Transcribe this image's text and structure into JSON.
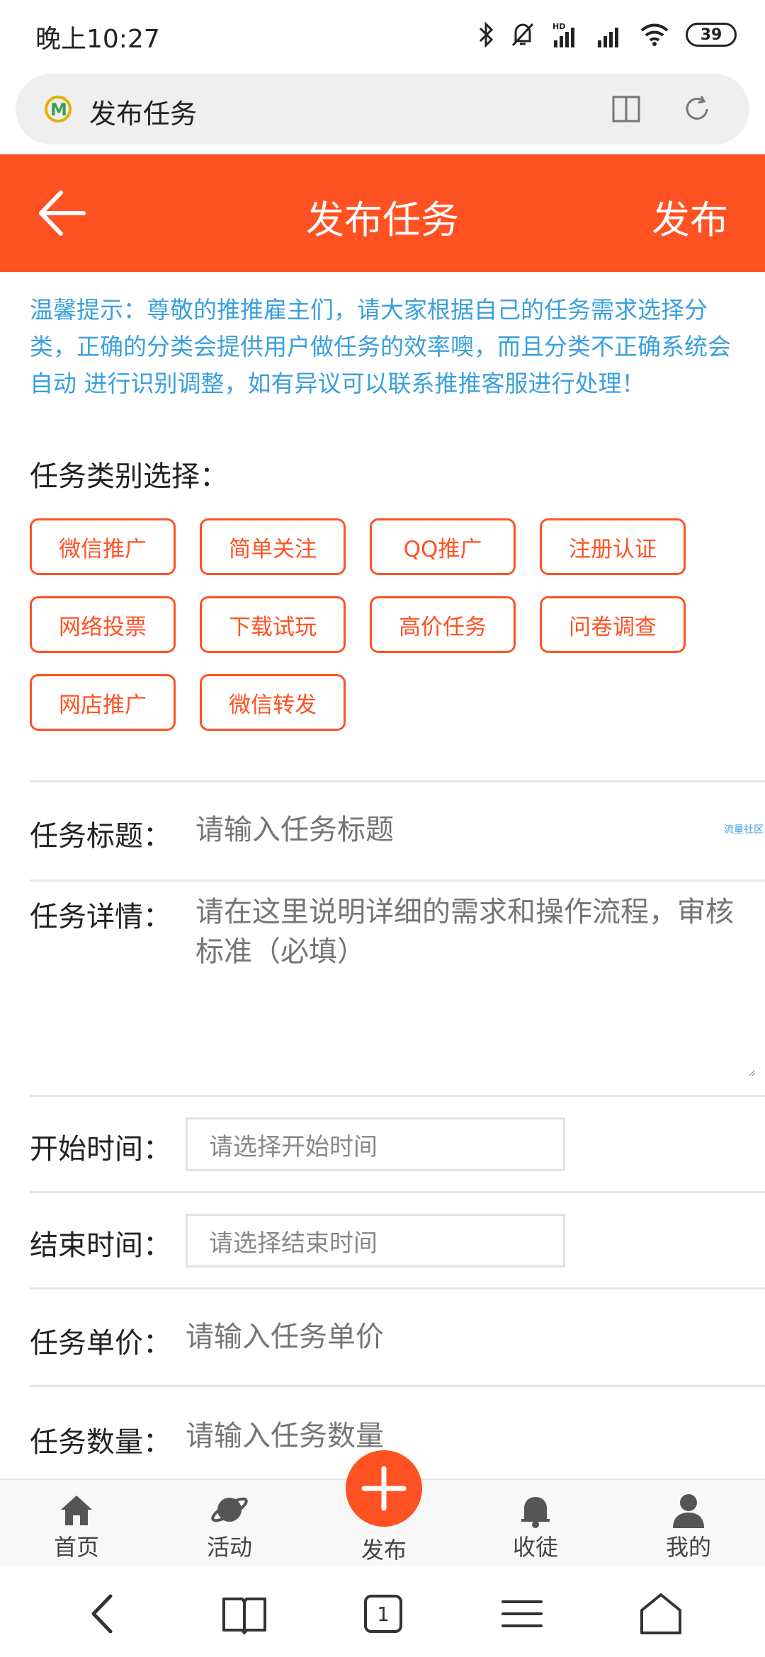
{
  "status_bar": {
    "time": "晚上10:27",
    "battery": "39",
    "icons": [
      "bluetooth-icon",
      "bell-muted-icon",
      "hd-signal-icon",
      "signal-icon",
      "wifi-icon",
      "battery-icon"
    ]
  },
  "browser": {
    "page_title": "发布任务",
    "logo_icon": "site-logo-icon",
    "reader_icon": "reader-mode-icon",
    "reload_icon": "reload-icon"
  },
  "header": {
    "title": "发布任务",
    "publish": "发布",
    "back_icon": "arrow-left-icon"
  },
  "tip": "温馨提示：尊敬的推推雇主们，请大家根据自己的任务需求选择分类，正确的分类会提供用户做任务的效率噢，而且分类不正确系统会自动 进行识别调整，如有异议可以联系推推客服进行处理！",
  "category_label": "任务类别选择：",
  "categories": [
    "微信推广",
    "简单关注",
    "QQ推广",
    "注册认证",
    "网络投票",
    "下载试玩",
    "高价任务",
    "问卷调查",
    "网店推广",
    "微信转发"
  ],
  "form": {
    "title_label": "任务标题：",
    "title_placeholder": "请输入任务标题",
    "detail_label": "任务详情：",
    "detail_placeholder": "请在这里说明详细的需求和操作流程，审核标准（必填）",
    "start_label": "开始时间：",
    "start_placeholder": "请选择开始时间",
    "end_label": "结束时间：",
    "end_placeholder": "请选择结束时间",
    "price_label": "任务单价：",
    "price_placeholder": "请输入任务单价",
    "qty_label": "任务数量：",
    "qty_placeholder": "请输入任务数量"
  },
  "watermark": "流量社区",
  "colors": {
    "accent": "#ff5223",
    "tip_text": "#3aa0dd"
  },
  "tabbar": {
    "tabs": [
      {
        "label": "首页",
        "icon": "home-icon"
      },
      {
        "label": "活动",
        "icon": "planet-icon"
      },
      {
        "label": "发布",
        "icon": "plus-icon"
      },
      {
        "label": "收徒",
        "icon": "bell-icon"
      },
      {
        "label": "我的",
        "icon": "user-icon"
      }
    ]
  },
  "system_nav": {
    "tab_count": "1",
    "icons": [
      "back-icon",
      "bookmarks-icon",
      "tabs-icon",
      "menu-icon",
      "home-outline-icon"
    ]
  }
}
